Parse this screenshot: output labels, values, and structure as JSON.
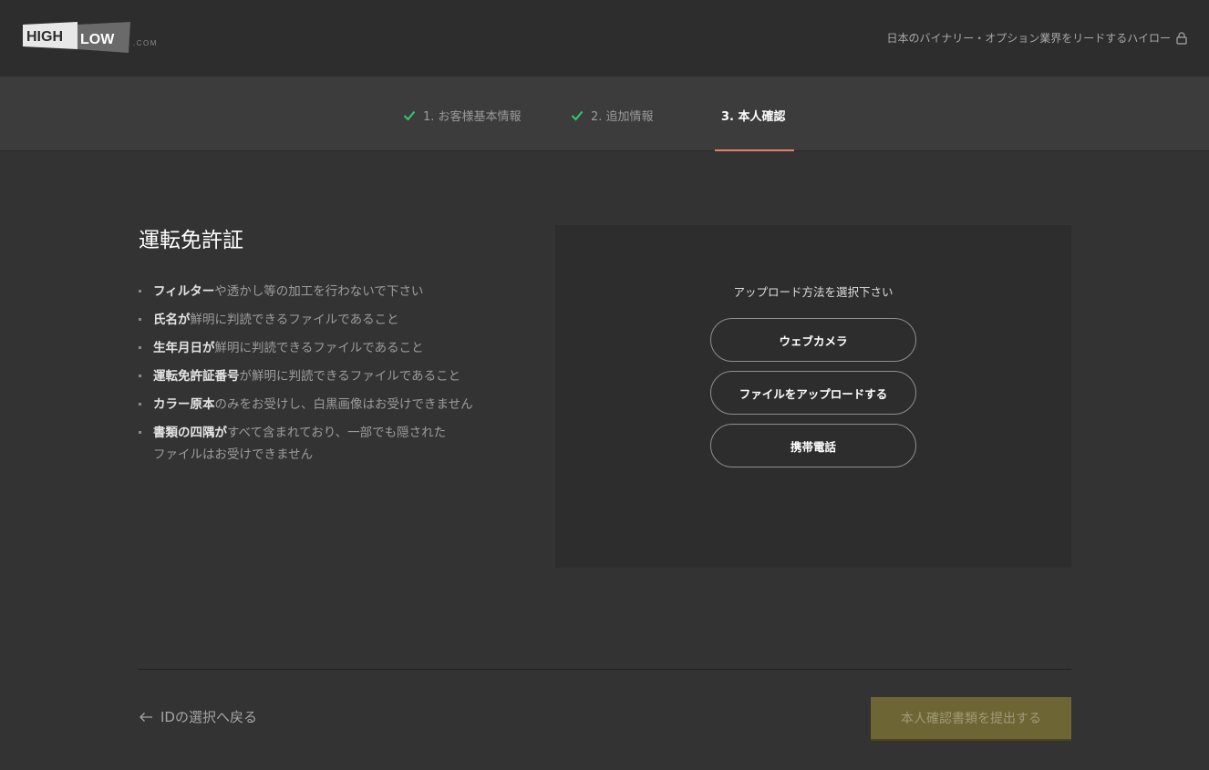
{
  "header": {
    "logo": {
      "word1": "HIGH",
      "word2": "LOW",
      "suffix": ".COM"
    },
    "tagline": "日本のバイナリー・オプション業界をリードするハイロー",
    "tagline_icon": "lock-icon"
  },
  "steps": [
    {
      "label": "1. お客様基本情報",
      "state": "completed",
      "icon": "check-icon"
    },
    {
      "label": "2. 追加情報",
      "state": "completed",
      "icon": "check-icon"
    },
    {
      "label": "3. 本人確認",
      "state": "active"
    }
  ],
  "document": {
    "title": "運転免許証",
    "requirements": [
      {
        "strong": "フィルター",
        "rest": "や透かし等の加工を行わないで下さい"
      },
      {
        "strong": "氏名が",
        "rest": "鮮明に判読できるファイルであること"
      },
      {
        "strong": "生年月日が",
        "rest": "鮮明に判読できるファイルであること"
      },
      {
        "strong": "運転免許証番号",
        "rest": "が鮮明に判読できるファイルであること"
      },
      {
        "strong": "カラー原本",
        "rest": "のみをお受けし、白黒画像はお受けできません"
      },
      {
        "strong": "書類の四隅が",
        "rest": "すべて含まれており、一部でも隠された",
        "line2": "ファイルはお受けできません"
      }
    ]
  },
  "upload": {
    "prompt": "アップロード方法を選択下さい",
    "options": [
      "ウェブカメラ",
      "ファイルをアップロードする",
      "携帯電話"
    ]
  },
  "footer": {
    "back_label": "IDの選択へ戻る",
    "back_icon": "arrow-left-icon",
    "submit_label": "本人確認書類を提出する"
  },
  "colors": {
    "background": "#333333",
    "header": "#2d2d2d",
    "steps_bar": "#3c3c3c",
    "check": "#2ecc71",
    "active_underline": "#e0826a",
    "submit_disabled": "#6e6535"
  }
}
